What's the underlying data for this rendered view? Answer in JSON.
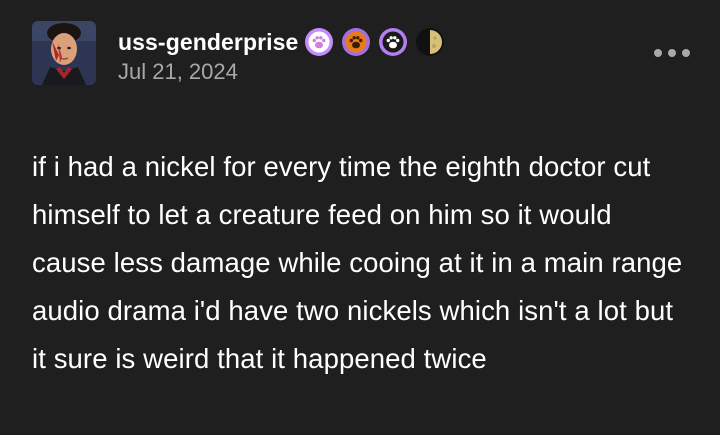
{
  "post": {
    "username": "uss-genderprise",
    "date": "Jul 21, 2024",
    "badges": [
      {
        "icon": "paw-white-badge-icon",
        "bg": "#c58cff",
        "paw": "#ffffff"
      },
      {
        "icon": "paw-orange-badge-icon",
        "bg": "#a36fe0",
        "paw": "#e87b1a"
      },
      {
        "icon": "paw-black-badge-icon",
        "bg": "#b37ef2",
        "paw": "#1a1a1a"
      },
      {
        "icon": "moon-badge-icon",
        "bg": "#111111",
        "moon": "#d7c07a"
      }
    ],
    "more_icon": "more-options-icon",
    "body": "if i had a nickel for every time the eighth doctor cut himself to let a creature feed on him so it would cause less damage while cooing at it in a main range audio drama i'd have two nickels which isn't a lot but it sure is weird that it happened twice"
  },
  "colors": {
    "background": "#1f1f1f",
    "text": "#ffffff",
    "secondary_text": "#a8a8a8"
  }
}
